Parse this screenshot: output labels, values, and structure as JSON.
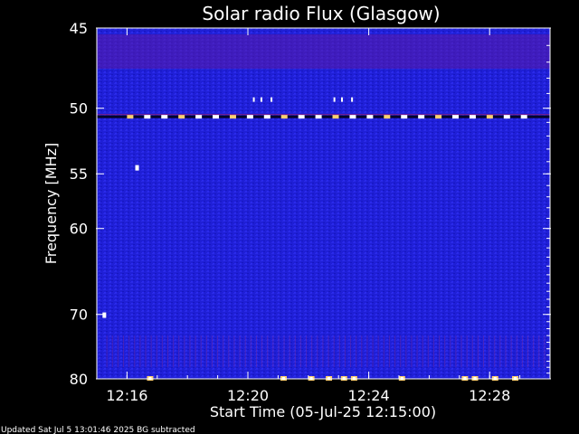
{
  "chart_data": {
    "type": "heatmap",
    "title": "Solar radio Flux (Glasgow)",
    "xlabel": "Start Time (05-Jul-25 12:15:00)",
    "ylabel": "Frequency [MHz]",
    "x_unit": "HH:MM (UT)",
    "xlim": [
      "12:15:00",
      "12:30:00"
    ],
    "ylim": [
      45,
      80
    ],
    "y_scale": "inverted, frequency increasing downward (log-like)",
    "x_ticks": [
      "12:16",
      "12:20",
      "12:24",
      "12:28"
    ],
    "y_ticks": [
      45,
      50,
      55,
      60,
      70,
      80
    ],
    "colors": {
      "background": "#000000",
      "low": "#1a1ad8",
      "mid": "#c02060",
      "high": "#ffffff",
      "hot": "#ffd070"
    },
    "features": [
      {
        "name": "persistent interference band",
        "frequency_mhz": 50.6,
        "time_range": [
          "12:15:00",
          "12:30:00"
        ]
      },
      {
        "name": "elevated band",
        "frequency_mhz_range": [
          45,
          49
        ],
        "time_range": [
          "12:15:00",
          "12:30:00"
        ]
      },
      {
        "name": "interference bursts",
        "frequency_mhz": 49.5,
        "times": [
          "12:20:10",
          "12:20:25",
          "12:20:45",
          "12:22:50",
          "12:23:05",
          "12:23:25"
        ]
      },
      {
        "name": "bright spikes",
        "frequency_mhz": 80,
        "times": [
          "12:16:45",
          "12:21:10",
          "12:22:05",
          "12:22:40",
          "12:23:10",
          "12:23:30",
          "12:25:05",
          "12:27:10",
          "12:27:30",
          "12:28:10",
          "12:28:50"
        ]
      },
      {
        "name": "spot",
        "frequency_mhz": 70.1,
        "time": "12:15:15"
      },
      {
        "name": "spot",
        "frequency_mhz": 54.5,
        "time": "12:16:20"
      }
    ]
  },
  "footer": {
    "updated": "Updated Sat Jul  5 13:01:46 2025   BG subtracted"
  }
}
